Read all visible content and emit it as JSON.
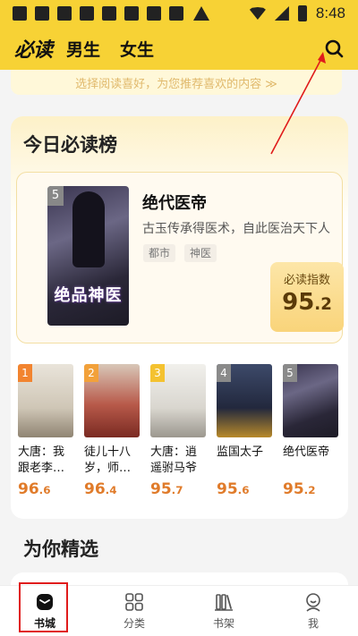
{
  "status_bar": {
    "time": "8:48"
  },
  "header": {
    "logo": "必读",
    "tabs": [
      "男生",
      "女生"
    ]
  },
  "preference": {
    "text": "选择阅读喜好，为您推荐喜欢的内容 ≫"
  },
  "ranking": {
    "title": "今日必读榜",
    "featured": {
      "rank": "5",
      "cover_art": "绝品神医",
      "title": "绝代医帝",
      "description": "古玉传承得医术，自此医治天下人",
      "tags": [
        "都市",
        "神医"
      ],
      "index_label": "必读指数",
      "index_value": "95.2"
    },
    "books": [
      {
        "rank": "1",
        "title": "大唐：我跟老李…",
        "score": "96.6",
        "rank_color": "#f2842f"
      },
      {
        "rank": "2",
        "title": "徒儿十八岁，师…",
        "score": "96.4",
        "rank_color": "#f2a13a"
      },
      {
        "rank": "3",
        "title": "大唐：逍遥驸马爷",
        "score": "95.7",
        "rank_color": "#f4c230"
      },
      {
        "rank": "4",
        "title": "监国太子",
        "score": "95.6",
        "rank_color": "#8a8a8a"
      },
      {
        "rank": "5",
        "title": "绝代医帝",
        "score": "95.2",
        "rank_color": "#8a8a8a"
      }
    ]
  },
  "section": {
    "title": "为你精选"
  },
  "bottom_nav": [
    {
      "label": "书城",
      "icon": "bookstore-icon",
      "active": true
    },
    {
      "label": "分类",
      "icon": "category-icon",
      "active": false
    },
    {
      "label": "书架",
      "icon": "bookshelf-icon",
      "active": false
    },
    {
      "label": "我",
      "icon": "profile-icon",
      "active": false
    }
  ],
  "colors": {
    "brand_yellow": "#f7d235",
    "score_orange": "#e07b2a",
    "annotation_red": "#e01b1b"
  }
}
